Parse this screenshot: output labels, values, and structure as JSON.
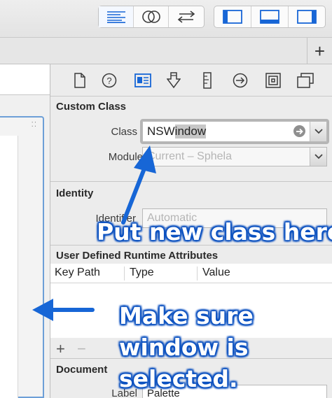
{
  "toolbar": {
    "editor_icons": [
      "standard-editor-icon",
      "assistant-editor-icon",
      "version-editor-icon"
    ],
    "view_icons": [
      "navigator-toggle-icon",
      "debug-area-toggle-icon",
      "utilities-toggle-icon"
    ]
  },
  "tabbar": {
    "add_tab_label": "+"
  },
  "inspector": {
    "tab_icons": [
      "file-inspector-icon",
      "quick-help-icon",
      "identity-inspector-icon",
      "attributes-inspector-icon",
      "size-inspector-icon",
      "connections-inspector-icon",
      "bindings-inspector-icon",
      "view-effects-inspector-icon"
    ],
    "custom_class": {
      "title": "Custom Class",
      "class_label": "Class",
      "class_value_plain": "NSW",
      "class_value_selected": "indow",
      "module_label": "Module",
      "module_placeholder": "Current – Sphela"
    },
    "identity": {
      "title": "Identity",
      "identifier_label": "Identifier",
      "identifier_placeholder": "Automatic"
    },
    "runtime_attributes": {
      "title": "User Defined Runtime Attributes",
      "columns": [
        "Key Path",
        "Type",
        "Value"
      ],
      "add_label": "+",
      "remove_label": "−"
    },
    "document": {
      "title": "Document",
      "label_label": "Label",
      "label_value": "Palette"
    }
  },
  "annotations": {
    "class_hint": "Put new class here",
    "window_hint_line1": "Make sure",
    "window_hint_line2": "window is",
    "window_hint_line3": "selected."
  },
  "colors": {
    "accent_blue": "#1766d6",
    "annotation_text": "#ffffff",
    "selection_blue": "#2f6fd0"
  }
}
